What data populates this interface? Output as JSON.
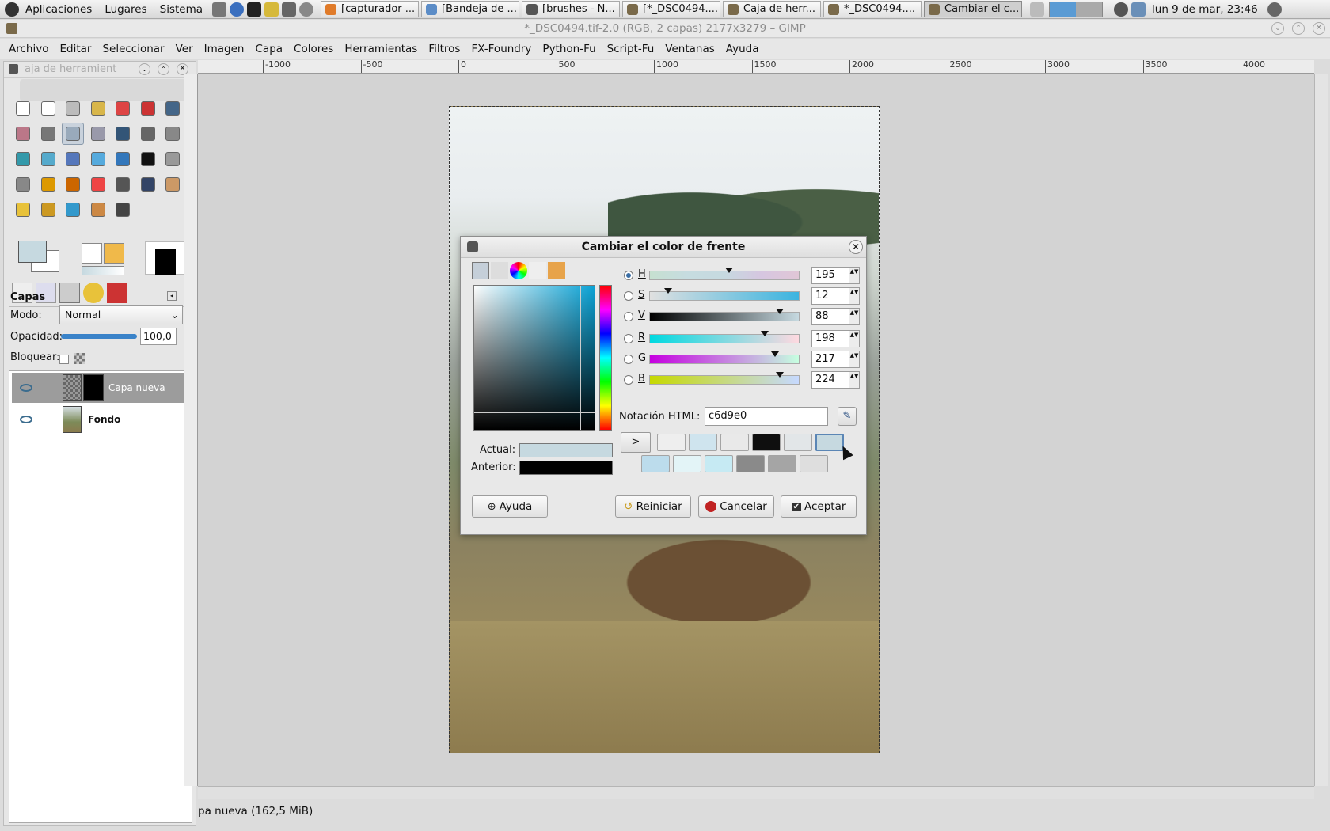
{
  "panel": {
    "menus": [
      "Aplicaciones",
      "Lugares",
      "Sistema"
    ],
    "tasks": [
      {
        "label": "[capturador ...",
        "color": "#e07b2a"
      },
      {
        "label": "[Bandeja de ...",
        "color": "#5b8cc7"
      },
      {
        "label": "[brushes - N...",
        "color": "#555555"
      },
      {
        "label": "[*_DSC0494....",
        "color": "#7a6a4a"
      },
      {
        "label": "Caja de herr...",
        "color": "#7a6a4a"
      },
      {
        "label": "*_DSC0494....",
        "color": "#7a6a4a"
      },
      {
        "label": "Cambiar el c...",
        "color": "#7a6a4a",
        "active": true
      }
    ],
    "clock": "lun  9 de mar, 23:46"
  },
  "window": {
    "title": "*_DSC0494.tif-2.0 (RGB, 2 capas) 2177x3279 – GIMP",
    "menu": [
      "Archivo",
      "Editar",
      "Seleccionar",
      "Ver",
      "Imagen",
      "Capa",
      "Colores",
      "Herramientas",
      "Filtros",
      "FX-Foundry",
      "Python-Fu",
      "Script-Fu",
      "Ventanas",
      "Ayuda"
    ]
  },
  "toolbox": {
    "title": "aja de herramient",
    "tool_icons": [
      "rect-select-icon",
      "ellipse-select-icon",
      "lasso-icon",
      "fuzzy-select-icon",
      "color-select-icon",
      "scissors-icon",
      "foreground-select-icon",
      "paths-icon",
      "color-picker-icon",
      "zoom-icon",
      "measure-icon",
      "move-icon",
      "align-icon",
      "crop-icon",
      "rotate-icon",
      "scale-icon",
      "shear-icon",
      "perspective-icon",
      "flip-icon",
      "text-icon",
      "bucket-fill-icon",
      "blend-icon",
      "pencil-icon",
      "paintbrush-icon",
      "eraser-icon",
      "airbrush-icon",
      "ink-icon",
      "clone-icon",
      "heal-icon",
      "perspective-clone-icon",
      "blur-icon",
      "smudge-icon",
      "dodge-icon"
    ],
    "fg_color": "#c6d9e0",
    "bg_color": "#ffffff",
    "layers_panel": {
      "title": "Capas",
      "mode_label": "Modo:",
      "mode_value": "Normal",
      "opacity_label": "Opacidad:",
      "opacity_value": "100,0",
      "lock_label": "Bloquear:",
      "layers": [
        {
          "name": "Capa nueva",
          "selected": true
        },
        {
          "name": "Fondo",
          "selected": false
        }
      ]
    }
  },
  "ruler": {
    "labels": [
      "-1000",
      "-500",
      "0",
      "500",
      "1000",
      "1500",
      "2000",
      "2500",
      "3000",
      "3500",
      "4000"
    ]
  },
  "dialog": {
    "title": "Cambiar el color de frente",
    "channels": [
      {
        "key": "H",
        "value": "195",
        "selected": true,
        "marker": 0.53
      },
      {
        "key": "S",
        "value": "12",
        "selected": false,
        "marker": 0.12
      },
      {
        "key": "V",
        "value": "88",
        "selected": false,
        "marker": 0.87
      },
      {
        "key": "R",
        "value": "198",
        "selected": false,
        "marker": 0.77
      },
      {
        "key": "G",
        "value": "217",
        "selected": false,
        "marker": 0.84
      },
      {
        "key": "B",
        "value": "224",
        "selected": false,
        "marker": 0.87
      }
    ],
    "html_label": "Notación HTML:",
    "html_value": "c6d9e0",
    "current_label": "Actual:",
    "previous_label": "Anterior:",
    "current_color": "#c6d9e0",
    "previous_color": "#000000",
    "history_arrow": ">",
    "history": [
      "#eeeeee",
      "#cfe4ee",
      "#e9e9e9",
      "#0f0f0f",
      "#e2e6e8",
      "#c6d9e0",
      "#bcdcec",
      "#e3f4f7",
      "#c6eaf3",
      "#8a8a8a",
      "#a5a5a5",
      "#dedede"
    ],
    "buttons": {
      "help": "Ayuda",
      "reset": "Reiniciar",
      "cancel": "Cancelar",
      "ok": "Aceptar"
    }
  },
  "status": {
    "text": "pa nueva (162,5 MiB)"
  }
}
